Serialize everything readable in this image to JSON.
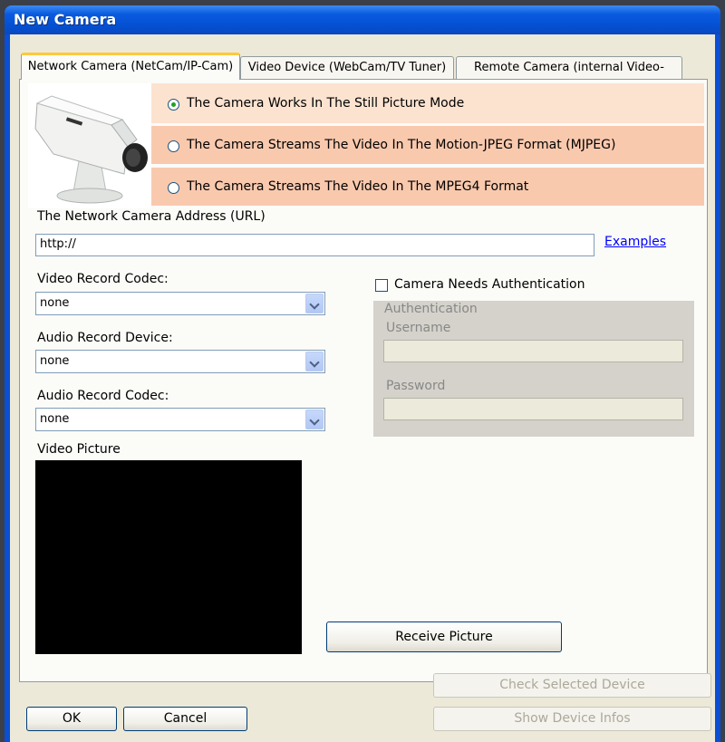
{
  "window": {
    "title": "New Camera"
  },
  "tabs": [
    {
      "label": "Network Camera (NetCam/IP-Cam)"
    },
    {
      "label": "Video Device (WebCam/TV Tuner)"
    },
    {
      "label": "Remote Camera (internal Video-Client)"
    }
  ],
  "modes": [
    {
      "label": "The Camera Works In The Still Picture Mode",
      "selected": true
    },
    {
      "label": "The Camera Streams The Video In The Motion-JPEG Format (MJPEG)",
      "selected": false
    },
    {
      "label": "The Camera Streams The Video In The MPEG4 Format",
      "selected": false
    }
  ],
  "address": {
    "label": "The Network Camera Address (URL)",
    "value": "http://",
    "examples_link": "Examples"
  },
  "video_codec": {
    "label": "Video Record Codec:",
    "value": "none"
  },
  "audio_device": {
    "label": "Audio Record Device:",
    "value": "none"
  },
  "audio_codec": {
    "label": "Audio Record Codec:",
    "value": "none"
  },
  "auth": {
    "checkbox_label": "Camera Needs Authentication",
    "group_label": "Authentication",
    "username_label": "Username",
    "password_label": "Password"
  },
  "video_picture_label": "Video Picture",
  "buttons": {
    "receive": "Receive Picture",
    "check_device": "Check Selected Device",
    "show_infos": "Show Device Infos",
    "ok": "OK",
    "cancel": "Cancel"
  }
}
